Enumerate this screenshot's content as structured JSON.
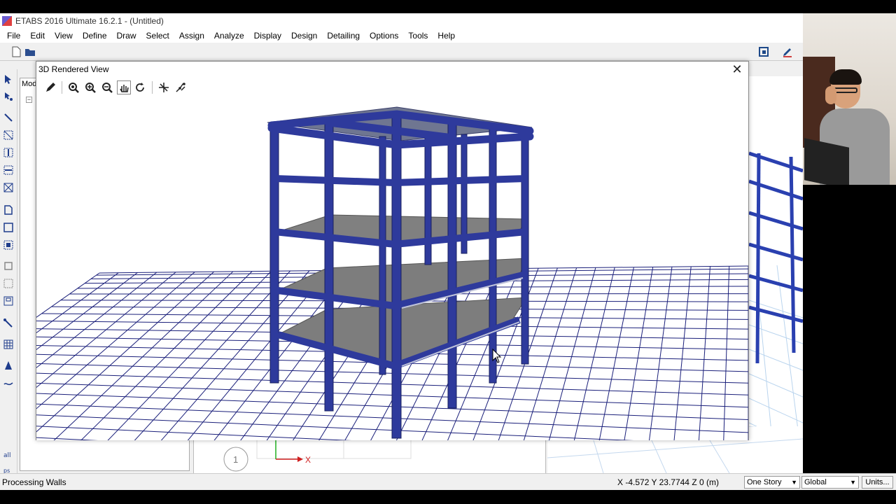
{
  "window": {
    "title": "ETABS 2016 Ultimate 16.2.1 - (Untitled)"
  },
  "menu": [
    "File",
    "Edit",
    "View",
    "Define",
    "Draw",
    "Select",
    "Assign",
    "Analyze",
    "Display",
    "Design",
    "Detailing",
    "Options",
    "Tools",
    "Help"
  ],
  "model_panel": {
    "tab_label": "Mod",
    "tree_toggle": "−"
  },
  "dialog": {
    "title": "3D Rendered View",
    "close_glyph": "✕",
    "tools": [
      "pencil-icon",
      "zoom-window-icon",
      "zoom-in-icon",
      "zoom-out-icon",
      "pan-icon",
      "rotate-icon",
      "view-options-icon",
      "3d-view-icon"
    ]
  },
  "axis_widget": {
    "bubble_label": "1",
    "x_label": "X"
  },
  "status": {
    "message": "Processing Walls",
    "coords": "X -4.572  Y 23.7744  Z 0 (m)",
    "story_combo": "One Story",
    "coord_combo": "Global",
    "units_button": "Units..."
  },
  "colors": {
    "frame": "#2e3a9c",
    "slab": "#7d7d7d",
    "grid": "#1a1f7a",
    "axis_x": "#d02020",
    "axis_y": "#20b020"
  }
}
